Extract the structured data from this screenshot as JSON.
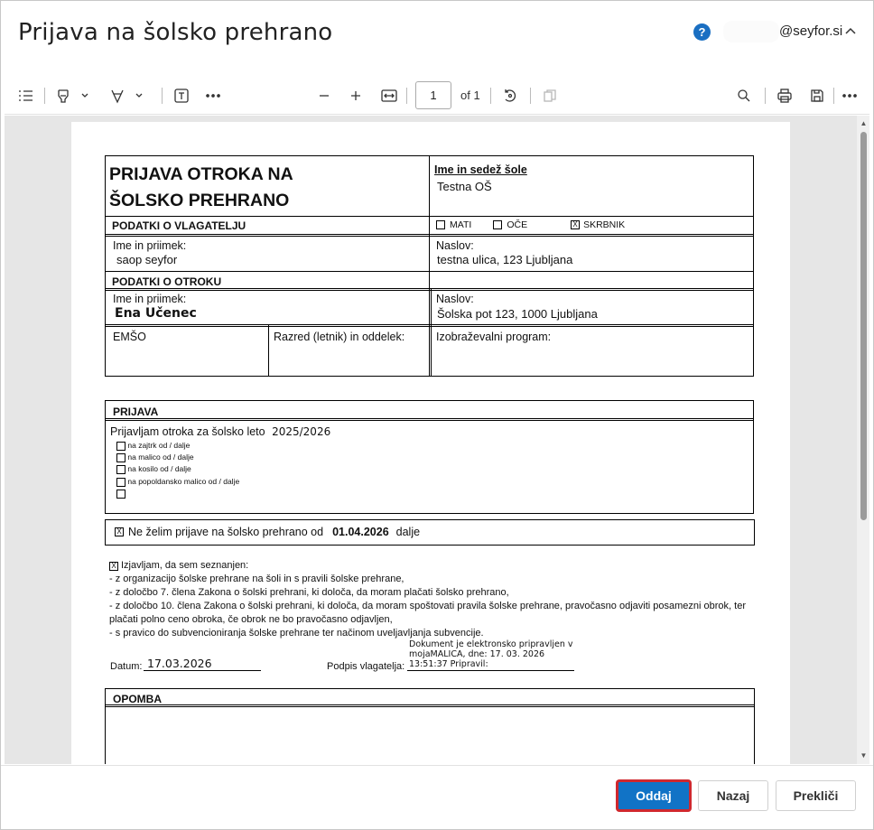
{
  "dialog": {
    "title": "Prijava na šolsko prehrano",
    "help_icon_glyph": "?",
    "user_email": "@seyfor.si"
  },
  "toolbar": {
    "page_number": "1",
    "page_total": "of 1"
  },
  "form": {
    "main_title_line1": "PRIJAVA OTROKA NA",
    "main_title_line2": "ŠOLSKO PREHRANO",
    "school_label": "Ime in sedež šole",
    "school_value": "Testna OŠ",
    "applicant_section": "PODATKI O VLAGATELJU",
    "role_mother": "MATI",
    "role_father": "OČE",
    "role_guardian": "SKRBNIK",
    "role_guardian_mark": "X",
    "name_label": "Ime in priimek:",
    "applicant_name": "saop seyfor",
    "address_label": "Naslov:",
    "applicant_address": "testna ulica, 123 Ljubljana",
    "child_section": "PODATKI O OTROKU",
    "child_name_label": "Ime in priimek:",
    "child_name": "Ena Učenec",
    "child_address_label": "Naslov:",
    "child_address": "Šolska pot 123, 1000 Ljubljana",
    "emso_label": "EMŠO",
    "class_label": "Razred (letnik) in oddelek:",
    "program_label": "Izobraževalni program:",
    "registration_section": "PRIJAVA",
    "registration_text": "Prijavljam otroka za šolsko leto",
    "school_year": "2025/2026",
    "meal_breakfast": "na zajtrk od / dalje",
    "meal_snack": "na malico od / dalje",
    "meal_lunch": "na kosilo od / dalje",
    "meal_afternoon": "na popoldansko malico od / dalje",
    "no_registration_mark": "X",
    "no_registration_text": "Ne želim prijave na šolsko prehrano od",
    "no_registration_date": "01.04.2026",
    "no_registration_suffix": "dalje",
    "declaration_mark": "X",
    "declaration_title": "Izjavljam, da sem seznanjen:",
    "declaration_1": "- z organizacijo šolske prehrane na šoli in s pravili šolske prehrane,",
    "declaration_2": "- z določbo 7. člena Zakona o šolski prehrani, ki določa, da moram plačati šolsko prehrano,",
    "declaration_3": "- z določbo 10. člena Zakona o šolski prehrani, ki določa, da moram spoštovati pravila šolske prehrane, pravočasno odjaviti posamezni obrok, ter",
    "declaration_4": "plačati polno ceno obroka, če obrok ne bo pravočasno odjavljen,",
    "declaration_5": "- s pravico do subvencioniranja šolske prehrane ter  načinom uveljavljanja subvencije.",
    "date_label": "Datum:",
    "date_value": "17.03.2026",
    "signature_label": "Podpis vlagatelja:",
    "signature_line1": "Dokument je elektronsko pripravljen v",
    "signature_line2": "mojaMALICA, dne: 17. 03. 2026",
    "signature_line3": "13:51:37 Pripravil:",
    "note_section": "OPOMBA"
  },
  "footer": {
    "submit_label": "Oddaj",
    "back_label": "Nazaj",
    "cancel_label": "Prekliči"
  },
  "colors": {
    "primary": "#1173c6",
    "focus_outline": "#d0282e",
    "help_icon": "#1a6fc2"
  }
}
